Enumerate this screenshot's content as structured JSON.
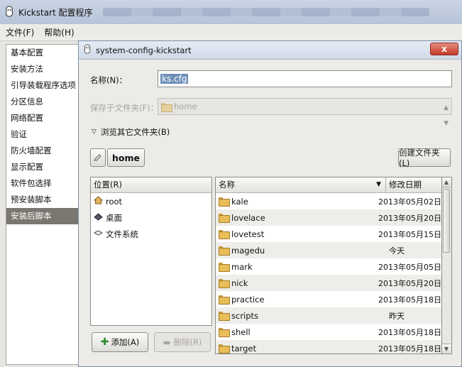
{
  "app": {
    "title": "Kickstart 配置程序",
    "menu": [
      "文件(F)",
      "帮助(H)"
    ]
  },
  "sidebar": {
    "items": [
      {
        "label": "基本配置"
      },
      {
        "label": "安装方法"
      },
      {
        "label": "引导装载程序选项"
      },
      {
        "label": "分区信息"
      },
      {
        "label": "网络配置"
      },
      {
        "label": "验证"
      },
      {
        "label": "防火墙配置"
      },
      {
        "label": "显示配置"
      },
      {
        "label": "软件包选择"
      },
      {
        "label": "预安装脚本"
      },
      {
        "label": "安装后脚本",
        "selected": true
      }
    ]
  },
  "dialog": {
    "title": "system-config-kickstart",
    "close_label": "x",
    "name_label": "名称(N)：",
    "name_value": "ks.cfg",
    "save_folder_label": "保存于文件夹(F)：",
    "save_folder_value": "home",
    "browse_label": "浏览其它文件夹(B)",
    "path_current": "home",
    "create_folder_label": "创建文件夹(L)",
    "places_header": "位置(R)",
    "places": [
      {
        "label": "root",
        "icon": "home-icon"
      },
      {
        "label": "桌面",
        "icon": "desktop-icon"
      },
      {
        "label": "文件系统",
        "icon": "drive-icon"
      }
    ],
    "add_label": "添加(A)",
    "remove_label": "删除(R)",
    "files_header": {
      "name": "名称",
      "date": "修改日期"
    },
    "files": [
      {
        "name": "kale",
        "date": "2013年05月02日"
      },
      {
        "name": "lovelace",
        "date": "2013年05月20日"
      },
      {
        "name": "lovetest",
        "date": "2013年05月15日"
      },
      {
        "name": "magedu",
        "date": "今天"
      },
      {
        "name": "mark",
        "date": "2013年05月05日"
      },
      {
        "name": "nick",
        "date": "2013年05月20日"
      },
      {
        "name": "practice",
        "date": "2013年05月18日"
      },
      {
        "name": "scripts",
        "date": "昨天"
      },
      {
        "name": "shell",
        "date": "2013年05月18日"
      },
      {
        "name": "target",
        "date": "2013年05月18日"
      }
    ]
  }
}
